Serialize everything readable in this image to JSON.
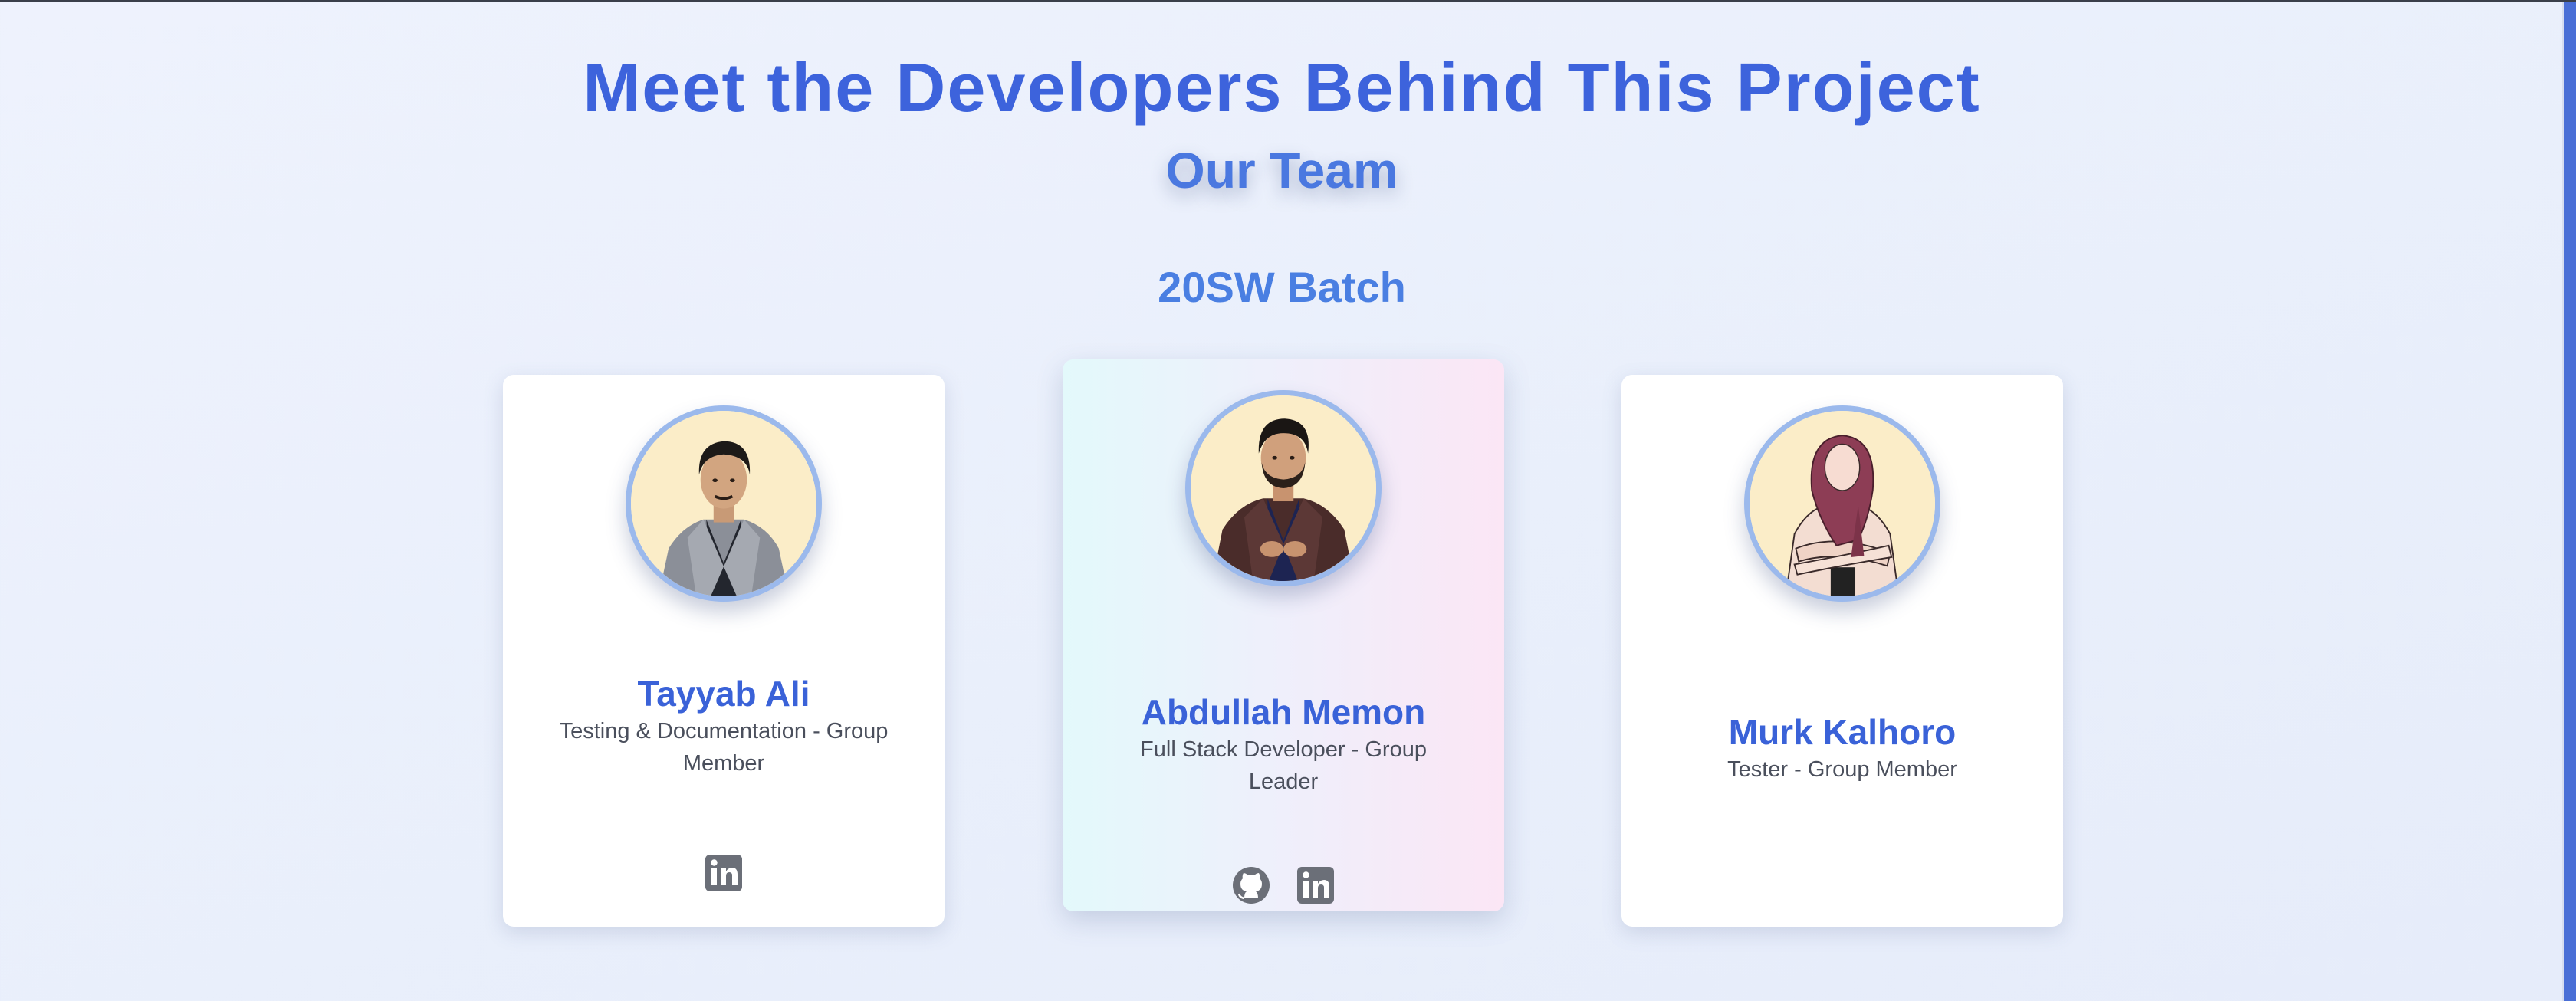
{
  "header": {
    "title": "Meet the Developers Behind This Project",
    "subtitle": "Our Team",
    "batch": "20SW Batch"
  },
  "team": [
    {
      "name": "Tayyab Ali",
      "role": "Testing & Documentation - Group Member",
      "socials": [
        "linkedin-icon"
      ]
    },
    {
      "name": "Abdullah Memon",
      "role": "Full Stack Developer - Group Leader",
      "socials": [
        "github-icon",
        "linkedin-icon"
      ]
    },
    {
      "name": "Murk Kalhoro",
      "role": "Tester - Group Member",
      "socials": []
    }
  ],
  "colors": {
    "title": "#3d63dc",
    "subtitle": "#4a78e0",
    "name": "#3a62d8",
    "role_text": "#4a4f5c",
    "avatar_border": "#9bb9ec",
    "avatar_bg": "#fbedc8",
    "icon": "#6b6f78",
    "scrollbar": "#4a6fd6"
  }
}
